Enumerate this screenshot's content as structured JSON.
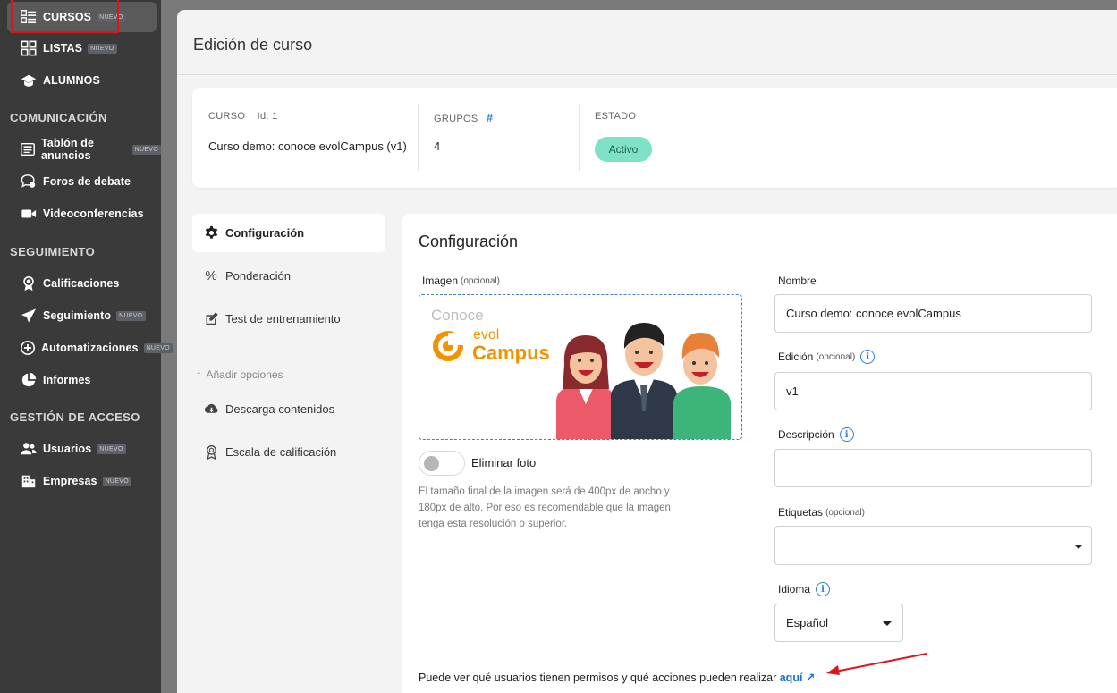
{
  "sidebar": {
    "items": [
      {
        "label": "CURSOS",
        "badge": "NUEVO",
        "icon": "list-icon"
      },
      {
        "label": "LISTAS",
        "badge": "NUEVO",
        "icon": "grid-icon"
      },
      {
        "label": "ALUMNOS",
        "badge": "",
        "icon": "graduation-cap-icon"
      }
    ],
    "sections": [
      {
        "title": "COMUNICACIÓN",
        "items": [
          {
            "label": "Tablón de anuncios",
            "badge": "NUEVO",
            "icon": "newspaper-icon"
          },
          {
            "label": "Foros de debate",
            "badge": "",
            "icon": "forum-icon"
          },
          {
            "label": "Videoconferencias",
            "badge": "",
            "icon": "video-icon"
          }
        ]
      },
      {
        "title": "SEGUIMIENTO",
        "items": [
          {
            "label": "Calificaciones",
            "badge": "",
            "icon": "award-icon"
          },
          {
            "label": "Seguimiento",
            "badge": "NUEVO",
            "icon": "send-icon"
          },
          {
            "label": "Automatizaciones",
            "badge": "NUEVO",
            "icon": "plus-circle-icon"
          },
          {
            "label": "Informes",
            "badge": "",
            "icon": "pie-chart-icon"
          }
        ]
      },
      {
        "title": "GESTIÓN DE ACCESO",
        "items": [
          {
            "label": "Usuarios",
            "badge": "NUEVO",
            "icon": "users-icon"
          },
          {
            "label": "Empresas",
            "badge": "NUEVO",
            "icon": "building-icon"
          }
        ]
      }
    ]
  },
  "page": {
    "title": "Edición de curso"
  },
  "course": {
    "curso_label": "CURSO",
    "id_label": "Id: 1",
    "name": "Curso demo: conoce evolCampus (v1)",
    "grupos_label": "GRUPOS",
    "grupos_icon": "#",
    "grupos_value": "4",
    "estado_label": "ESTADO",
    "estado_value": "Activo"
  },
  "left_nav": {
    "items": [
      {
        "label": "Configuración",
        "icon": "gear-icon",
        "active": true
      },
      {
        "label": "Ponderación",
        "icon": "percent-icon",
        "active": false
      },
      {
        "label": "Test de entrenamiento",
        "icon": "edit-icon",
        "active": false
      }
    ],
    "add_options": "Añadir opciones",
    "extra": [
      {
        "label": "Descarga contenidos",
        "icon": "cloud-download-icon"
      },
      {
        "label": "Escala de calificación",
        "icon": "award-icon"
      }
    ]
  },
  "config": {
    "title": "Configuración",
    "image_label": "Imagen",
    "image_optional": "(opcional)",
    "logo_conoce": "Conoce",
    "logo_evol": "evol",
    "logo_campus": "Campus",
    "remove_photo": "Eliminar foto",
    "image_help": "El tamaño final de la imagen será de 400px de ancho y 180px de alto. Por eso es recomendable que la imagen tenga esta resolución o superior.",
    "name_label": "Nombre",
    "name_value": "Curso demo: conoce evolCampus",
    "edition_label": "Edición",
    "edition_optional": "(opcional)",
    "edition_value": "v1",
    "description_label": "Descripción",
    "description_value": "",
    "tags_label": "Etiquetas",
    "tags_optional": "(opcional)",
    "tags_value": "",
    "language_label": "Idioma",
    "language_value": "Español",
    "info_glyph": "i",
    "permissions_text": "Puede ver qué usuarios tienen permisos y qué acciones pueden realizar",
    "permissions_link": "aquí",
    "permissions_link_icon": "↗"
  },
  "colors": {
    "sidebar_bg": "#3a3a3a",
    "accent_blue": "#2f7fd8",
    "status_green": "#7de2c6",
    "highlight_red": "#e0141e",
    "logo_orange": "#f39200"
  }
}
